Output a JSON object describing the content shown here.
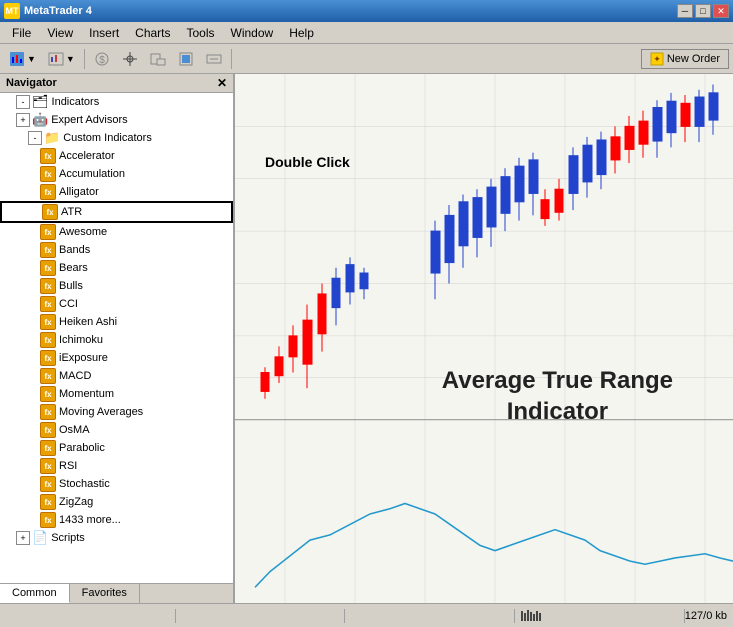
{
  "titleBar": {
    "title": "MetaTrader 4",
    "minBtn": "─",
    "maxBtn": "□",
    "closeBtn": "✕"
  },
  "menuBar": {
    "items": [
      "File",
      "View",
      "Insert",
      "Charts",
      "Tools",
      "Window",
      "Help"
    ]
  },
  "toolbar": {
    "newOrderBtn": "New Order"
  },
  "navigator": {
    "title": "Navigator",
    "closeBtn": "✕",
    "treeItems": [
      {
        "label": "Indicators",
        "level": 1,
        "type": "root",
        "expanded": true
      },
      {
        "label": "Expert Advisors",
        "level": 1,
        "type": "root",
        "expanded": false
      },
      {
        "label": "Custom Indicators",
        "level": 1,
        "type": "folder",
        "expanded": true
      },
      {
        "label": "Accelerator",
        "level": 2,
        "type": "indicator"
      },
      {
        "label": "Accumulation",
        "level": 2,
        "type": "indicator"
      },
      {
        "label": "Alligator",
        "level": 2,
        "type": "indicator"
      },
      {
        "label": "ATR",
        "level": 2,
        "type": "indicator",
        "highlighted": true
      },
      {
        "label": "Awesome",
        "level": 2,
        "type": "indicator"
      },
      {
        "label": "Bands",
        "level": 2,
        "type": "indicator"
      },
      {
        "label": "Bears",
        "level": 2,
        "type": "indicator"
      },
      {
        "label": "Bulls",
        "level": 2,
        "type": "indicator"
      },
      {
        "label": "CCI",
        "level": 2,
        "type": "indicator"
      },
      {
        "label": "Heiken Ashi",
        "level": 2,
        "type": "indicator"
      },
      {
        "label": "Ichimoku",
        "level": 2,
        "type": "indicator"
      },
      {
        "label": "iExposure",
        "level": 2,
        "type": "indicator"
      },
      {
        "label": "MACD",
        "level": 2,
        "type": "indicator"
      },
      {
        "label": "Momentum",
        "level": 2,
        "type": "indicator"
      },
      {
        "label": "Moving Averages",
        "level": 2,
        "type": "indicator"
      },
      {
        "label": "OsMA",
        "level": 2,
        "type": "indicator"
      },
      {
        "label": "Parabolic",
        "level": 2,
        "type": "indicator"
      },
      {
        "label": "RSI",
        "level": 2,
        "type": "indicator"
      },
      {
        "label": "Stochastic",
        "level": 2,
        "type": "indicator"
      },
      {
        "label": "ZigZag",
        "level": 2,
        "type": "indicator"
      },
      {
        "label": "1433 more...",
        "level": 2,
        "type": "more"
      },
      {
        "label": "Scripts",
        "level": 1,
        "type": "root",
        "expanded": false
      }
    ],
    "tabs": [
      {
        "label": "Common",
        "active": true
      },
      {
        "label": "Favorites",
        "active": false
      }
    ]
  },
  "chart": {
    "doubleClickLabel": "Double Click",
    "atrLabel": "Average True Range\nIndicator"
  },
  "statusBar": {
    "sections": [
      "",
      "",
      "",
      ""
    ],
    "rightText": "127/0 kb"
  }
}
